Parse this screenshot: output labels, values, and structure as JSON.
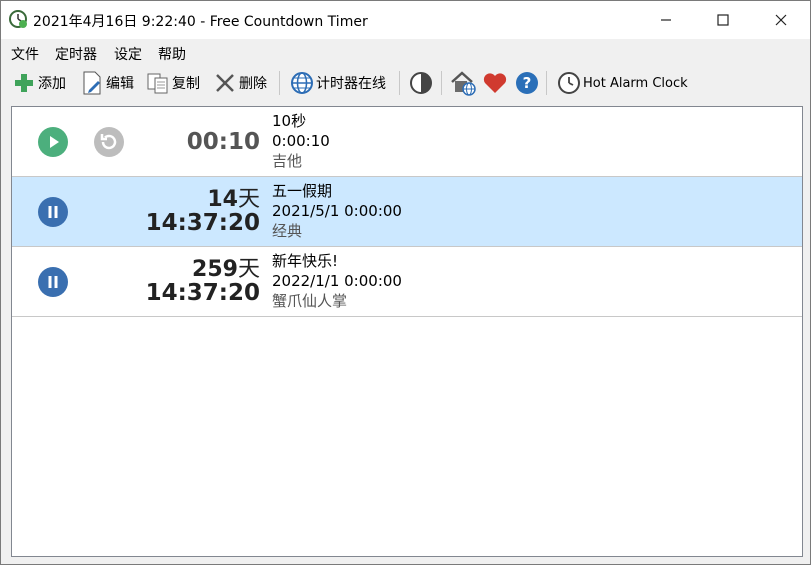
{
  "window": {
    "title": "2021年4月16日 9:22:40 - Free Countdown Timer"
  },
  "menu": {
    "items": [
      "文件",
      "定时器",
      "设定",
      "帮助"
    ]
  },
  "toolbar": {
    "add_label": "添加",
    "edit_label": "编辑",
    "copy_label": "复制",
    "delete_label": "删除",
    "online_label": "计时器在线",
    "hot_alarm_label": "Hot Alarm Clock"
  },
  "timers": [
    {
      "state": "stopped",
      "countdown_time": "00:10",
      "name": "10秒",
      "target": "0:00:10",
      "sound": "吉他"
    },
    {
      "state": "running",
      "countdown_days": "14",
      "countdown_days_unit": "天",
      "countdown_time": "14:37:20",
      "name": "五一假期",
      "target": "2021/5/1 0:00:00",
      "sound": "经典"
    },
    {
      "state": "running",
      "countdown_days": "259",
      "countdown_days_unit": "天",
      "countdown_time": "14:37:20",
      "name": "新年快乐!",
      "target": "2022/1/1 0:00:00",
      "sound": "蟹爪仙人掌"
    }
  ],
  "colors": {
    "play": "#4caf7d",
    "pause": "#3a6fb0",
    "heart": "#d03a2f",
    "help": "#2a6fb8",
    "selected_row": "#cce8ff"
  }
}
